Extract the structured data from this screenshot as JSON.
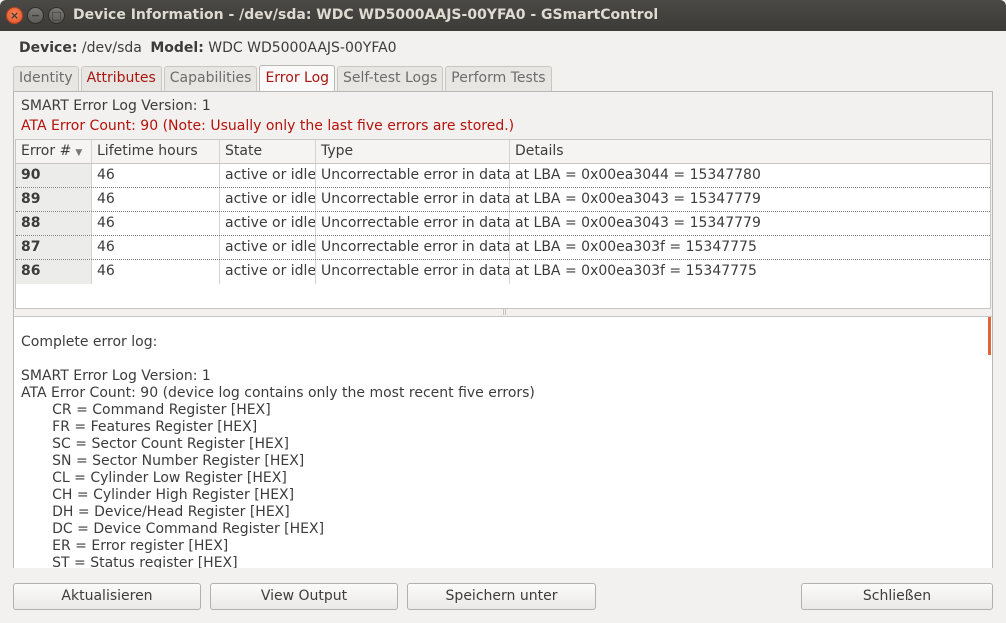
{
  "window": {
    "title": "Device Information - /dev/sda: WDC WD5000AAJS-00YFA0 - GSmartControl",
    "close_glyph": "×",
    "min_glyph": "−",
    "max_glyph": "□"
  },
  "device": {
    "device_label": "Device:",
    "device_value": "/dev/sda",
    "model_label": "Model:",
    "model_value": "WDC WD5000AAJS-00YFA0"
  },
  "tabs": [
    {
      "label": "Identity"
    },
    {
      "label": "Attributes"
    },
    {
      "label": "Capabilities"
    },
    {
      "label": "Error Log"
    },
    {
      "label": "Self-test Logs"
    },
    {
      "label": "Perform Tests"
    }
  ],
  "error_log": {
    "version_line": "SMART Error Log Version: 1",
    "count_line": "ATA Error Count: 90 (Note: Usually only the last five errors are stored.)",
    "table": {
      "headers": [
        "Error #",
        "Lifetime hours",
        "State",
        "Type",
        "Details"
      ],
      "sort_indicator": "▼",
      "rows": [
        [
          "90",
          "46",
          "active or idle",
          "Uncorrectable error in data",
          "at LBA = 0x00ea3044 = 15347780"
        ],
        [
          "89",
          "46",
          "active or idle",
          "Uncorrectable error in data",
          "at LBA = 0x00ea3043 = 15347779"
        ],
        [
          "88",
          "46",
          "active or idle",
          "Uncorrectable error in data",
          "at LBA = 0x00ea3043 = 15347779"
        ],
        [
          "87",
          "46",
          "active or idle",
          "Uncorrectable error in data",
          "at LBA = 0x00ea303f = 15347775"
        ],
        [
          "86",
          "46",
          "active or idle",
          "Uncorrectable error in data",
          "at LBA = 0x00ea303f = 15347775"
        ]
      ]
    },
    "splitter_glyph": "⠿",
    "complete_log": "Complete error log:\n\nSMART Error Log Version: 1\nATA Error Count: 90 (device log contains only the most recent five errors)\n       CR = Command Register [HEX]\n       FR = Features Register [HEX]\n       SC = Sector Count Register [HEX]\n       SN = Sector Number Register [HEX]\n       CL = Cylinder Low Register [HEX]\n       CH = Cylinder High Register [HEX]\n       DH = Device/Head Register [HEX]\n       DC = Device Command Register [HEX]\n       ER = Error register [HEX]\n       ST = Status register [HEX]"
  },
  "buttons": {
    "refresh": "Aktualisieren",
    "view_output": "View Output",
    "save_as": "Speichern unter",
    "close": "Schließen"
  },
  "colors": {
    "error_red": "#b5120b",
    "accent_orange": "#e0653a"
  }
}
